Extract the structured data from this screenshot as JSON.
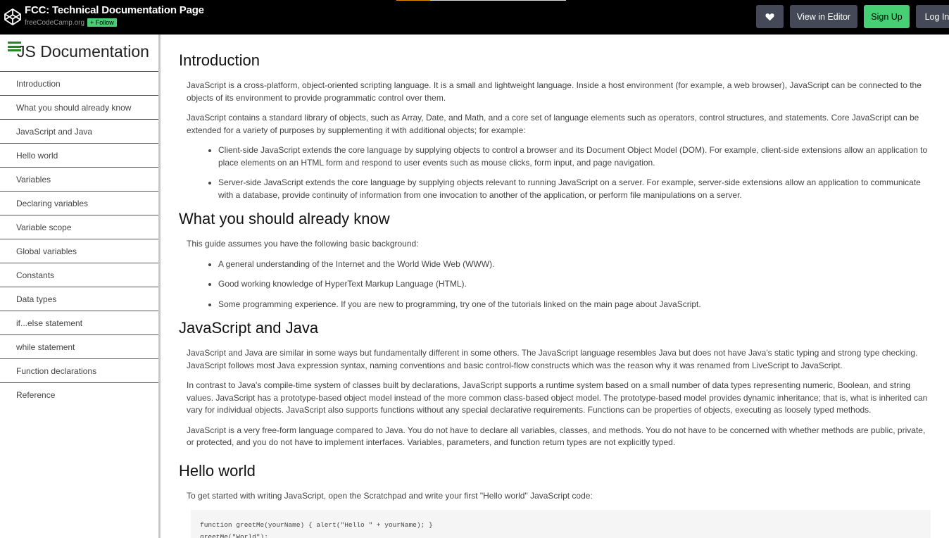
{
  "codepen": {
    "title": "FCC: Technical Documentation Page",
    "owner": "freeCodeCamp.org",
    "follow_label": "+ Follow",
    "view_editor_label": "View in Editor",
    "signup_label": "Sign Up",
    "login_label": "Log In",
    "heart_icon": "heart-icon",
    "accent": "#47cf73"
  },
  "sidebar": {
    "title": "JS Documentation",
    "items": [
      {
        "label": "Introduction"
      },
      {
        "label": "What you should already know"
      },
      {
        "label": "JavaScript and Java"
      },
      {
        "label": "Hello world"
      },
      {
        "label": "Variables"
      },
      {
        "label": "Declaring variables"
      },
      {
        "label": "Variable scope"
      },
      {
        "label": "Global variables"
      },
      {
        "label": "Constants"
      },
      {
        "label": "Data types"
      },
      {
        "label": "if...else statement"
      },
      {
        "label": "while statement"
      },
      {
        "label": "Function declarations"
      },
      {
        "label": "Reference"
      }
    ]
  },
  "main": {
    "intro": {
      "heading": "Introduction",
      "p1": "JavaScript is a cross-platform, object-oriented scripting language. It is a small and lightweight language. Inside a host environment (for example, a web browser), JavaScript can be connected to the objects of its environment to provide programmatic control over them.",
      "p2": "JavaScript contains a standard library of objects, such as Array, Date, and Math, and a core set of language elements such as operators, control structures, and statements. Core JavaScript can be extended for a variety of purposes by supplementing it with additional objects; for example:",
      "li1": "Client-side JavaScript extends the core language by supplying objects to control a browser and its Document Object Model (DOM). For example, client-side extensions allow an application to place elements on an HTML form and respond to user events such as mouse clicks, form input, and page navigation.",
      "li2": "Server-side JavaScript extends the core language by supplying objects relevant to running JavaScript on a server. For example, server-side extensions allow an application to communicate with a database, provide continuity of information from one invocation to another of the application, or perform file manipulations on a server."
    },
    "know": {
      "heading": "What you should already know",
      "p1": "This guide assumes you have the following basic background:",
      "li1": "A general understanding of the Internet and the World Wide Web (WWW).",
      "li2": "Good working knowledge of HyperText Markup Language (HTML).",
      "li3": "Some programming experience. If you are new to programming, try one of the tutorials linked on the main page about JavaScript."
    },
    "java": {
      "heading": "JavaScript and Java",
      "p1": "JavaScript and Java are similar in some ways but fundamentally different in some others. The JavaScript language resembles Java but does not have Java's static typing and strong type checking. JavaScript follows most Java expression syntax, naming conventions and basic control-flow constructs which was the reason why it was renamed from LiveScript to JavaScript.",
      "p2": "In contrast to Java's compile-time system of classes built by declarations, JavaScript supports a runtime system based on a small number of data types representing numeric, Boolean, and string values. JavaScript has a prototype-based object model instead of the more common class-based object model. The prototype-based model provides dynamic inheritance; that is, what is inherited can vary for individual objects. JavaScript also supports functions without any special declarative requirements. Functions can be properties of objects, executing as loosely typed methods.",
      "p3": "JavaScript is a very free-form language compared to Java. You do not have to declare all variables, classes, and methods. You do not have to be concerned with whether methods are public, private, or protected, and you do not have to implement interfaces. Variables, parameters, and function return types are not explicitly typed."
    },
    "hello": {
      "heading": "Hello world",
      "p1": "To get started with writing JavaScript, open the Scratchpad and write your first \"Hello world\" JavaScript code:",
      "code1": "function greetMe(yourName) { alert(\"Hello \" + yourName); }",
      "code2": "greetMe(\"World\");"
    }
  }
}
